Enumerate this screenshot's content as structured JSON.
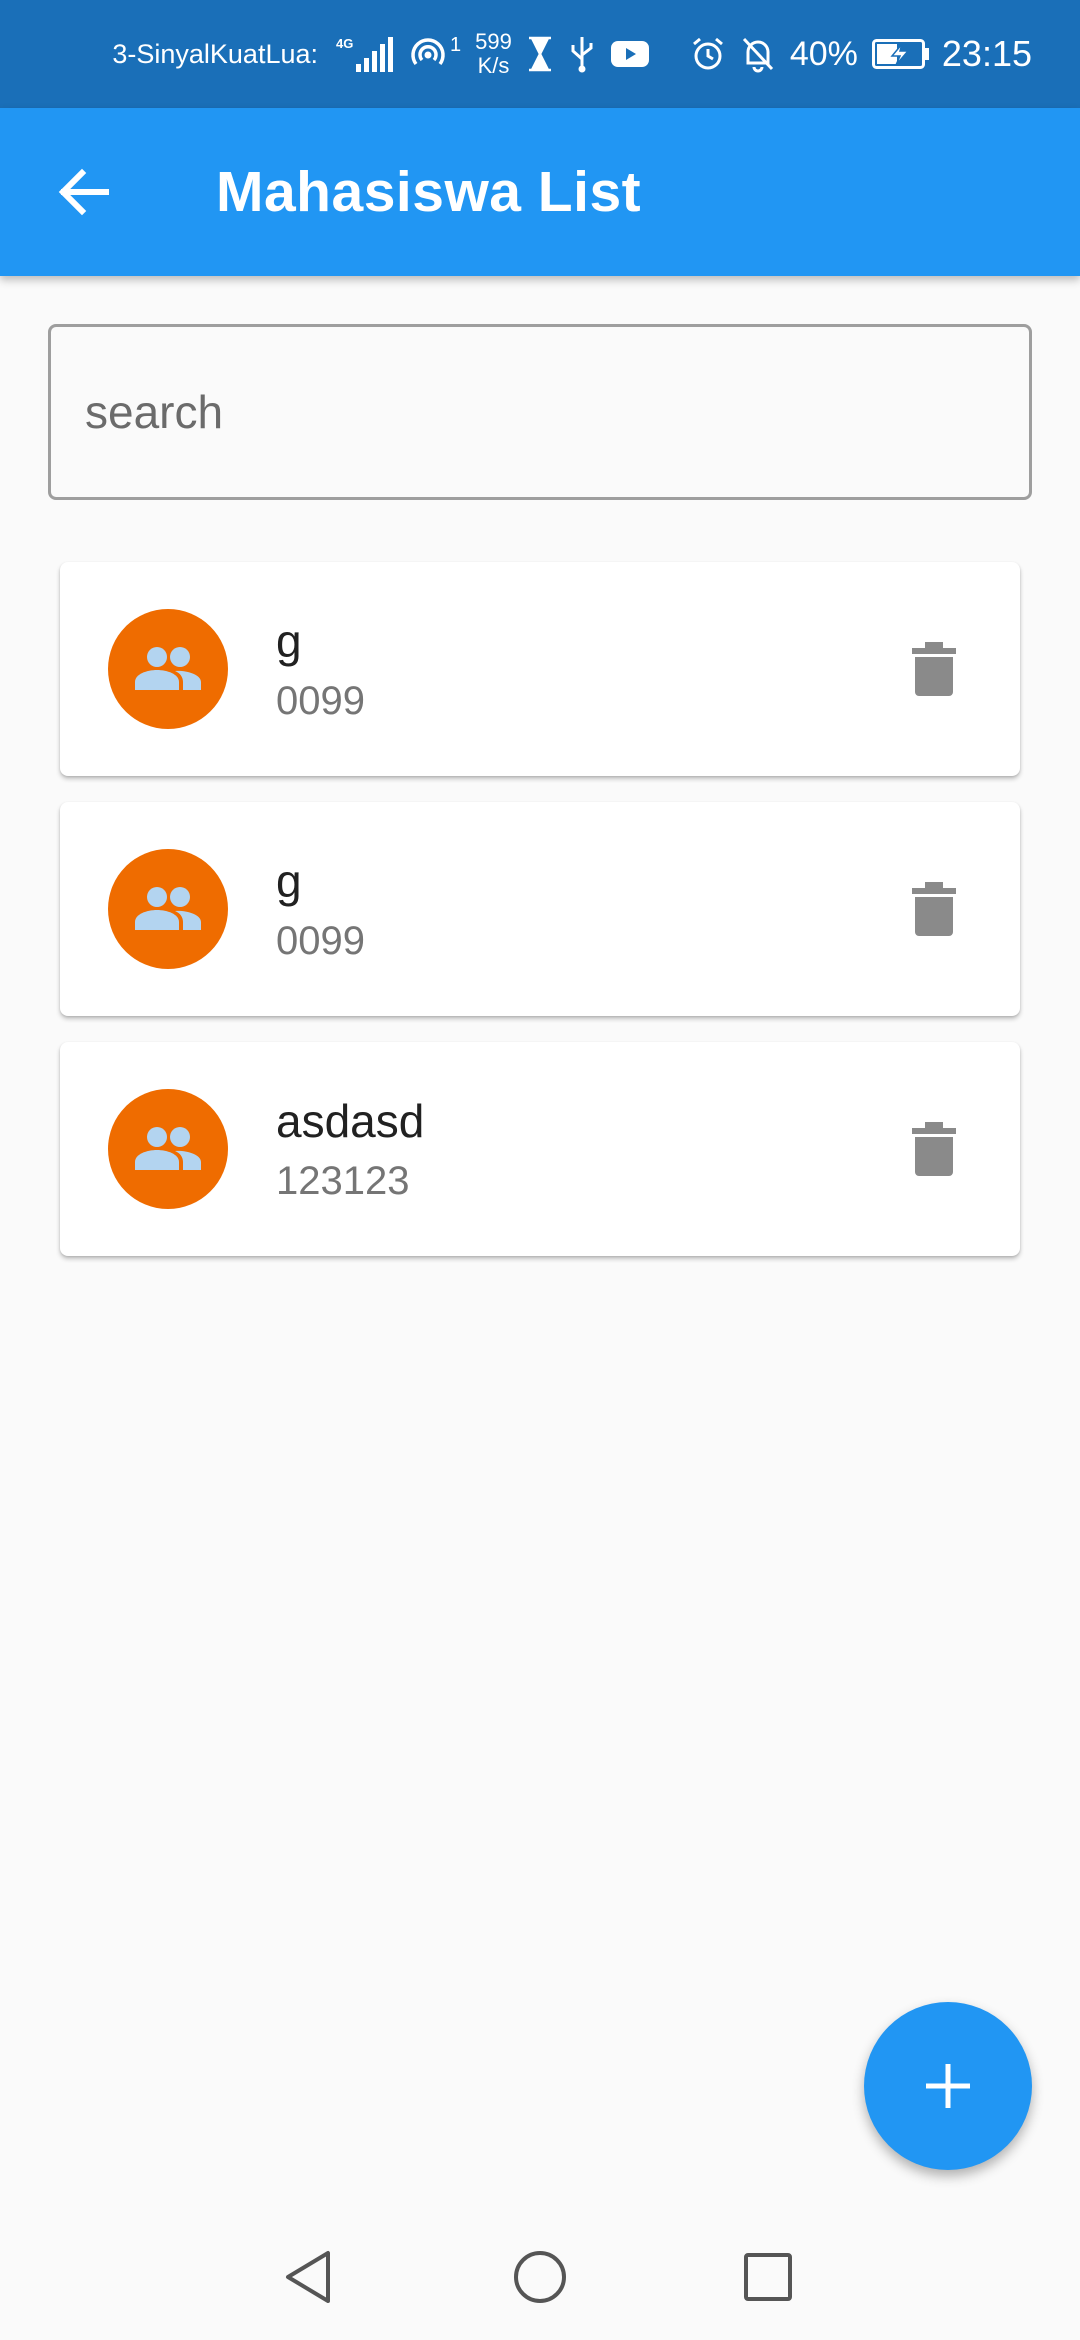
{
  "status_bar": {
    "carrier": "3-SinyalKuatLua:",
    "network_type": "4G",
    "hotspot_count": "1",
    "speed_value": "599",
    "speed_unit": "K/s",
    "battery": "40%",
    "time": "23:15"
  },
  "app_bar": {
    "title": "Mahasiswa List",
    "back_icon": "arrow-back-icon"
  },
  "search": {
    "placeholder": "search",
    "value": ""
  },
  "students": [
    {
      "name": "g",
      "nim": "0099",
      "avatar_icon": "people-icon",
      "action_icon": "trash-icon"
    },
    {
      "name": "g",
      "nim": "0099",
      "avatar_icon": "people-icon",
      "action_icon": "trash-icon"
    },
    {
      "name": "asdasd",
      "nim": "123123",
      "avatar_icon": "people-icon",
      "action_icon": "trash-icon"
    }
  ],
  "fab": {
    "icon": "plus-icon"
  },
  "nav": {
    "back": "triangle-back-icon",
    "home": "circle-home-icon",
    "recents": "square-recents-icon"
  },
  "colors": {
    "status_bar": "#1a6fb8",
    "primary": "#2196f3",
    "avatar": "#ef6c00",
    "avatar_icon": "#b3d4f0",
    "trash": "#8a8a8a"
  }
}
